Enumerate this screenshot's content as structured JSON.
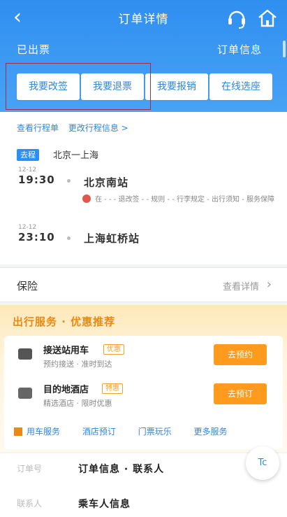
{
  "header": {
    "back_glyph": "‹",
    "title": "订单详情",
    "subtitle_left": "已出票",
    "subtitle_right": "订单信息"
  },
  "actions": [
    {
      "label": "我要改签"
    },
    {
      "label": "我要退票"
    },
    {
      "label": "我要报销"
    },
    {
      "label": "在线选座"
    }
  ],
  "trip": {
    "links": [
      "查看行程单",
      "更改行程信息 >"
    ],
    "tag": "去程",
    "route": "北京一上海",
    "dep_date": "12-12",
    "dep_time": "19:30",
    "dep_station": "北京南站",
    "note": "在 - - - 退改签 - - 规则 - - 行李规定 - 出行须知 - 服务保障",
    "arr_date": "12-12",
    "arr_time": "23:10",
    "arr_station": "上海虹桥站"
  },
  "insurance": {
    "label": "保险",
    "more": "查看详情"
  },
  "promo": {
    "title": "出行服务 · 优惠推荐",
    "items": [
      {
        "title": "接送站用车",
        "badge": "优惠",
        "sub": "预约接送 · 准时到达",
        "button": "去预约"
      },
      {
        "title": "目的地酒店",
        "badge": "特惠",
        "sub": "精选酒店 · 限时优惠",
        "button": "去预订"
      }
    ],
    "footer": [
      "用车服务",
      "酒店预订",
      "门票玩乐",
      "更多服务"
    ]
  },
  "bottom_rows": [
    {
      "label": "订单号",
      "value": "订单信息 · 联系人"
    },
    {
      "label": "联系人",
      "value": "乘车人信息"
    }
  ],
  "float_label": "Tc"
}
